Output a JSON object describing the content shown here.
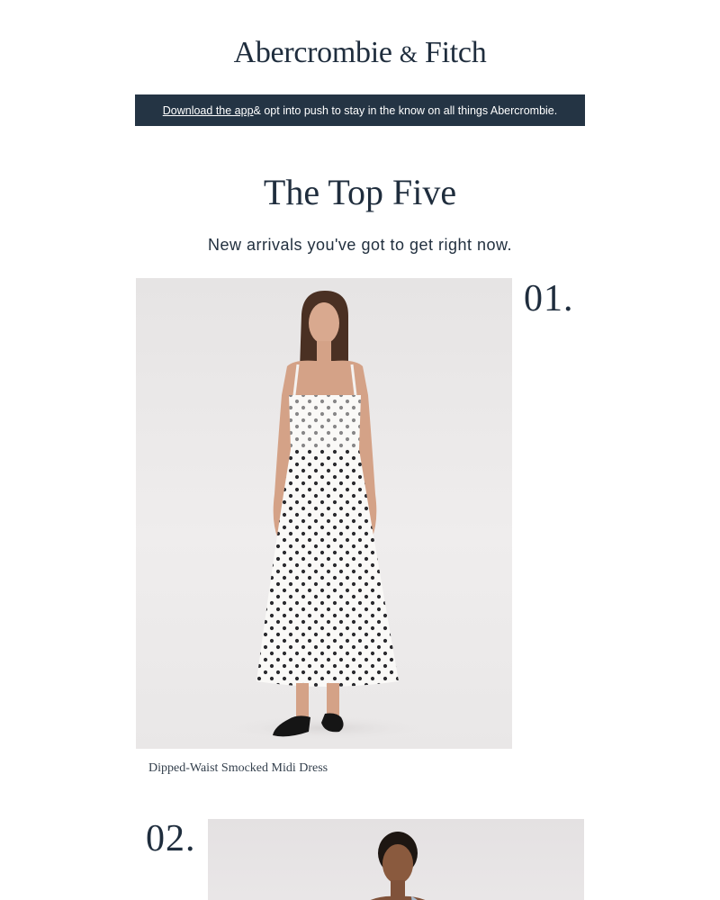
{
  "brand": {
    "name_part1": "Abercrombie",
    "ampersand": "&",
    "name_part2": "Fitch"
  },
  "promo": {
    "link_text": "Download the app",
    "text": " & opt into push to stay in the know on all things Abercrombie."
  },
  "headline": "The Top Five",
  "subhead": "New arrivals you've got to get right now.",
  "products": [
    {
      "rank": "01.",
      "name": "Dipped-Waist Smocked Midi Dress",
      "image_desc": "model-white-polka-dot-midi-dress"
    },
    {
      "rank": "02.",
      "name": "",
      "image_desc": "model-light-blue-top"
    }
  ],
  "colors": {
    "navy": "#243444",
    "text": "#1f2d3d",
    "image_bg": "#ebe9e9"
  }
}
